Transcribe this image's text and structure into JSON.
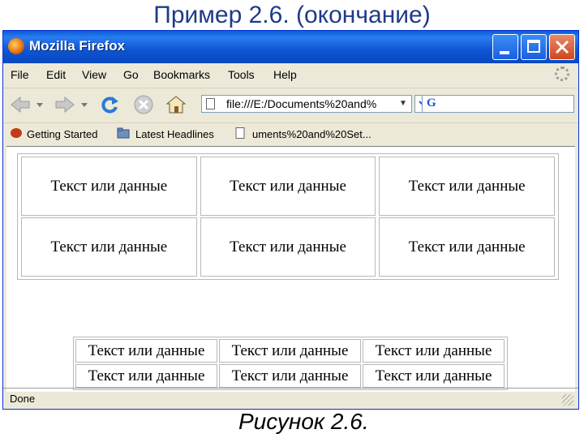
{
  "slide": {
    "title": "Пример 2.6. (окончание)",
    "caption": "Рисунок 2.6."
  },
  "window": {
    "title": "Mozilla Firefox",
    "controls": [
      "minimize-icon",
      "maximize-icon",
      "close-icon"
    ]
  },
  "menu": {
    "items": [
      {
        "label": "File",
        "icon": null
      },
      {
        "label": "Edit"
      },
      {
        "label": "View"
      },
      {
        "label": "Go"
      },
      {
        "label": "Bookmarks"
      },
      {
        "label": "Tools"
      },
      {
        "label": "Help"
      }
    ]
  },
  "navigation": {
    "url": "file:///E:/Documents%20and%",
    "icons": [
      "back-icon",
      "forward-icon",
      "reload-icon",
      "stop-icon",
      "home-icon",
      "go-icon",
      "search-engine-icon"
    ]
  },
  "bookmarks": {
    "items": [
      {
        "label": "Getting Started",
        "icon": "getting-started-icon"
      },
      {
        "label": "Latest Headlines",
        "icon": "rss-folder-icon"
      },
      {
        "label": "uments%20and%20Set...",
        "icon": "page-icon"
      }
    ]
  },
  "content": {
    "table1": {
      "rows": [
        [
          "Текст или данные",
          "Текст или данные",
          "Текст или данные"
        ],
        [
          "Текст или данные",
          "Текст или данные",
          "Текст или данные"
        ]
      ]
    },
    "table2": {
      "rows": [
        [
          "Текст или данные",
          "Текст или данные",
          "Текст или данные"
        ],
        [
          "Текст или данные",
          "Текст или данные",
          "Текст или данные"
        ]
      ]
    }
  },
  "status": {
    "text": "Done"
  },
  "colors": {
    "titlebar": "#0a5bd8",
    "slide_title": "#1f3a8a",
    "chrome": "#ece9d8"
  }
}
